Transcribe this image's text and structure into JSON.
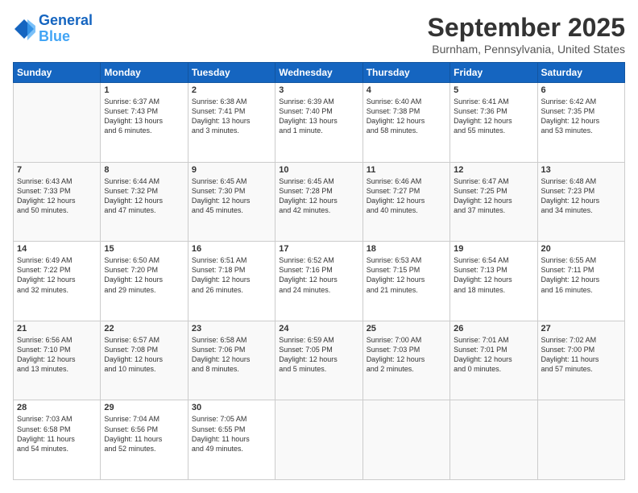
{
  "header": {
    "logo_line1": "General",
    "logo_line2": "Blue",
    "month": "September 2025",
    "location": "Burnham, Pennsylvania, United States"
  },
  "weekdays": [
    "Sunday",
    "Monday",
    "Tuesday",
    "Wednesday",
    "Thursday",
    "Friday",
    "Saturday"
  ],
  "weeks": [
    [
      {
        "day": "",
        "info": ""
      },
      {
        "day": "1",
        "info": "Sunrise: 6:37 AM\nSunset: 7:43 PM\nDaylight: 13 hours\nand 6 minutes."
      },
      {
        "day": "2",
        "info": "Sunrise: 6:38 AM\nSunset: 7:41 PM\nDaylight: 13 hours\nand 3 minutes."
      },
      {
        "day": "3",
        "info": "Sunrise: 6:39 AM\nSunset: 7:40 PM\nDaylight: 13 hours\nand 1 minute."
      },
      {
        "day": "4",
        "info": "Sunrise: 6:40 AM\nSunset: 7:38 PM\nDaylight: 12 hours\nand 58 minutes."
      },
      {
        "day": "5",
        "info": "Sunrise: 6:41 AM\nSunset: 7:36 PM\nDaylight: 12 hours\nand 55 minutes."
      },
      {
        "day": "6",
        "info": "Sunrise: 6:42 AM\nSunset: 7:35 PM\nDaylight: 12 hours\nand 53 minutes."
      }
    ],
    [
      {
        "day": "7",
        "info": "Sunrise: 6:43 AM\nSunset: 7:33 PM\nDaylight: 12 hours\nand 50 minutes."
      },
      {
        "day": "8",
        "info": "Sunrise: 6:44 AM\nSunset: 7:32 PM\nDaylight: 12 hours\nand 47 minutes."
      },
      {
        "day": "9",
        "info": "Sunrise: 6:45 AM\nSunset: 7:30 PM\nDaylight: 12 hours\nand 45 minutes."
      },
      {
        "day": "10",
        "info": "Sunrise: 6:45 AM\nSunset: 7:28 PM\nDaylight: 12 hours\nand 42 minutes."
      },
      {
        "day": "11",
        "info": "Sunrise: 6:46 AM\nSunset: 7:27 PM\nDaylight: 12 hours\nand 40 minutes."
      },
      {
        "day": "12",
        "info": "Sunrise: 6:47 AM\nSunset: 7:25 PM\nDaylight: 12 hours\nand 37 minutes."
      },
      {
        "day": "13",
        "info": "Sunrise: 6:48 AM\nSunset: 7:23 PM\nDaylight: 12 hours\nand 34 minutes."
      }
    ],
    [
      {
        "day": "14",
        "info": "Sunrise: 6:49 AM\nSunset: 7:22 PM\nDaylight: 12 hours\nand 32 minutes."
      },
      {
        "day": "15",
        "info": "Sunrise: 6:50 AM\nSunset: 7:20 PM\nDaylight: 12 hours\nand 29 minutes."
      },
      {
        "day": "16",
        "info": "Sunrise: 6:51 AM\nSunset: 7:18 PM\nDaylight: 12 hours\nand 26 minutes."
      },
      {
        "day": "17",
        "info": "Sunrise: 6:52 AM\nSunset: 7:16 PM\nDaylight: 12 hours\nand 24 minutes."
      },
      {
        "day": "18",
        "info": "Sunrise: 6:53 AM\nSunset: 7:15 PM\nDaylight: 12 hours\nand 21 minutes."
      },
      {
        "day": "19",
        "info": "Sunrise: 6:54 AM\nSunset: 7:13 PM\nDaylight: 12 hours\nand 18 minutes."
      },
      {
        "day": "20",
        "info": "Sunrise: 6:55 AM\nSunset: 7:11 PM\nDaylight: 12 hours\nand 16 minutes."
      }
    ],
    [
      {
        "day": "21",
        "info": "Sunrise: 6:56 AM\nSunset: 7:10 PM\nDaylight: 12 hours\nand 13 minutes."
      },
      {
        "day": "22",
        "info": "Sunrise: 6:57 AM\nSunset: 7:08 PM\nDaylight: 12 hours\nand 10 minutes."
      },
      {
        "day": "23",
        "info": "Sunrise: 6:58 AM\nSunset: 7:06 PM\nDaylight: 12 hours\nand 8 minutes."
      },
      {
        "day": "24",
        "info": "Sunrise: 6:59 AM\nSunset: 7:05 PM\nDaylight: 12 hours\nand 5 minutes."
      },
      {
        "day": "25",
        "info": "Sunrise: 7:00 AM\nSunset: 7:03 PM\nDaylight: 12 hours\nand 2 minutes."
      },
      {
        "day": "26",
        "info": "Sunrise: 7:01 AM\nSunset: 7:01 PM\nDaylight: 12 hours\nand 0 minutes."
      },
      {
        "day": "27",
        "info": "Sunrise: 7:02 AM\nSunset: 7:00 PM\nDaylight: 11 hours\nand 57 minutes."
      }
    ],
    [
      {
        "day": "28",
        "info": "Sunrise: 7:03 AM\nSunset: 6:58 PM\nDaylight: 11 hours\nand 54 minutes."
      },
      {
        "day": "29",
        "info": "Sunrise: 7:04 AM\nSunset: 6:56 PM\nDaylight: 11 hours\nand 52 minutes."
      },
      {
        "day": "30",
        "info": "Sunrise: 7:05 AM\nSunset: 6:55 PM\nDaylight: 11 hours\nand 49 minutes."
      },
      {
        "day": "",
        "info": ""
      },
      {
        "day": "",
        "info": ""
      },
      {
        "day": "",
        "info": ""
      },
      {
        "day": "",
        "info": ""
      }
    ]
  ]
}
